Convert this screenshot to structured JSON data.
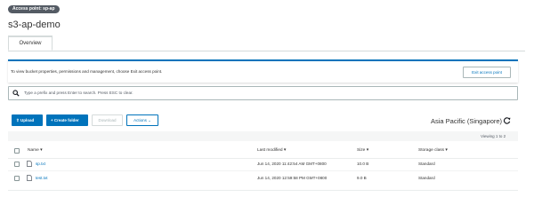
{
  "header": {
    "access_point_badge": "Access point: sp-ap",
    "title": "s3-ap-demo"
  },
  "tabs": [
    {
      "label": "Overview",
      "active": true
    }
  ],
  "info_banner": {
    "text": "To view bucket properties, permissions and management, choose Exit access point.",
    "exit_button_label": "Exit access point"
  },
  "search": {
    "placeholder": "Type a prefix and press Enter to search. Press ESC to clear."
  },
  "toolbar": {
    "upload_label": "Upload",
    "create_folder_label": "Create folder",
    "download_label": "Download",
    "actions_label": "Actions",
    "region": "Asia Pacific (Singapore)"
  },
  "table": {
    "viewing": "Viewing 1 to 2",
    "columns": {
      "name": "Name",
      "last_modified": "Last modified",
      "size": "Size",
      "storage_class": "Storage class"
    },
    "rows": [
      {
        "name": "sp.txt",
        "last_modified": "Jun 14, 2020 11:42:54 AM GMT+0800",
        "size": "10.0 B",
        "storage_class": "Standard"
      },
      {
        "name": "test.txt",
        "last_modified": "Jun 14, 2020 12:59:58 PM GMT+0800",
        "size": "9.0 B",
        "storage_class": "Standard"
      }
    ]
  },
  "colors": {
    "primary": "#0073bb",
    "border": "#aab7b8",
    "badge": "#545b64"
  }
}
